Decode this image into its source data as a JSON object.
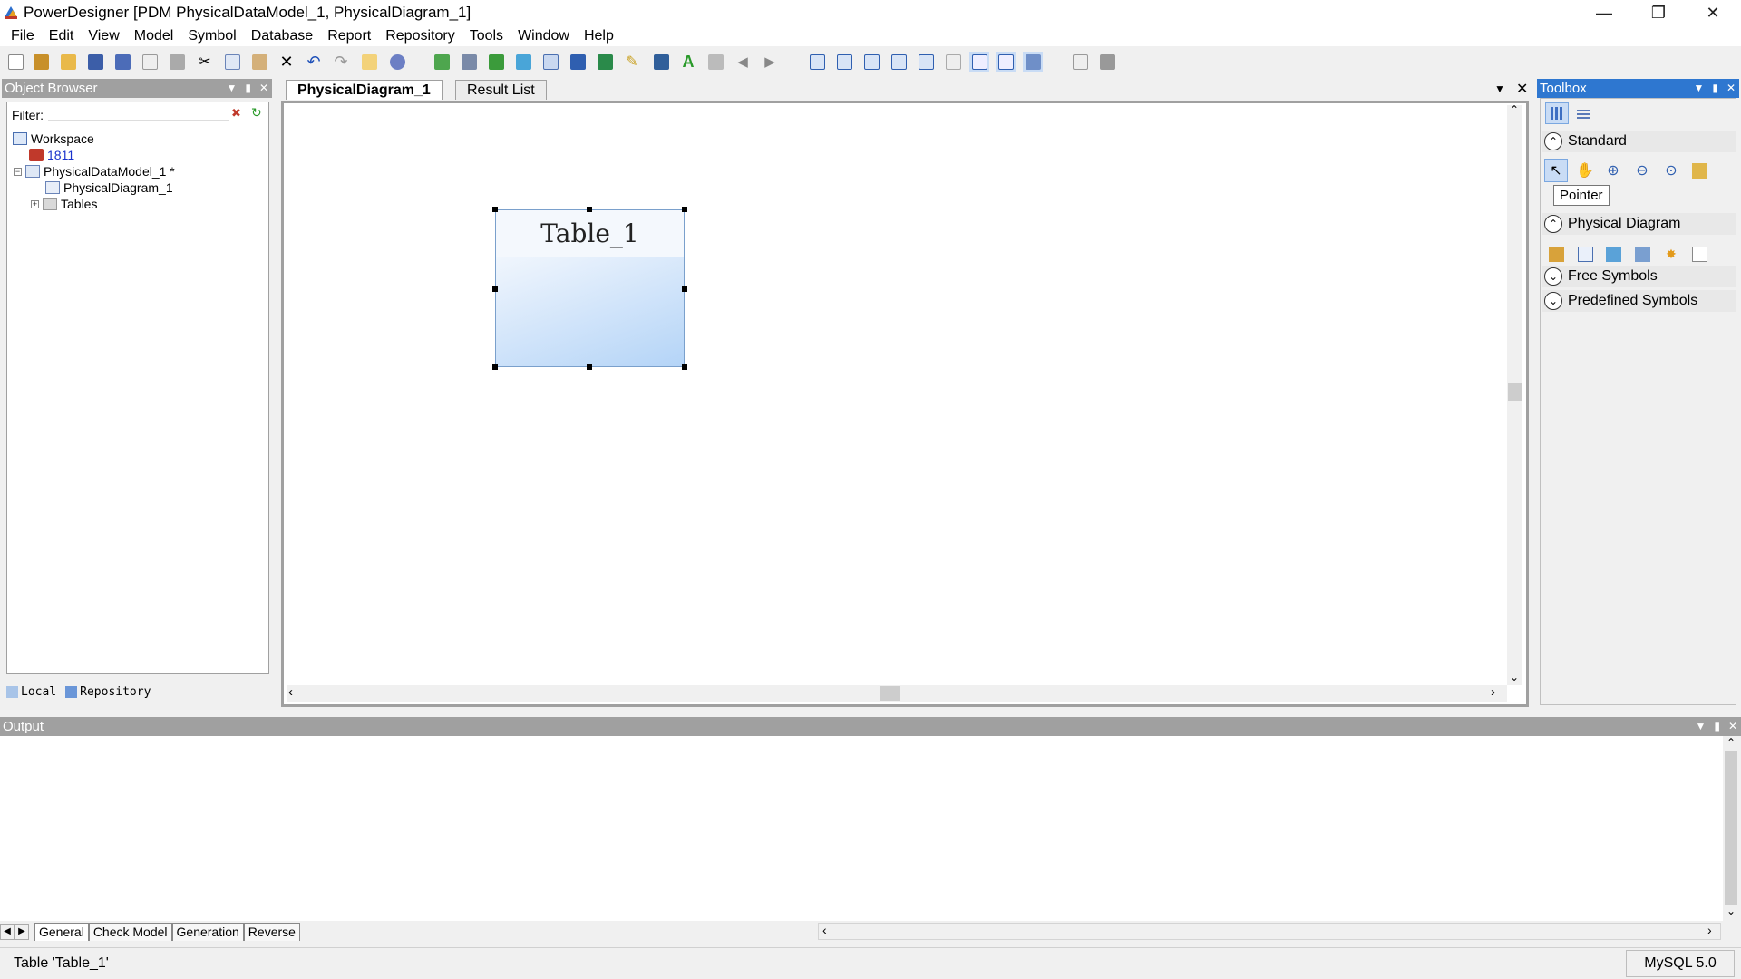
{
  "window": {
    "title": "PowerDesigner [PDM PhysicalDataModel_1, PhysicalDiagram_1]",
    "controls": [
      "minimize-icon",
      "restore-icon",
      "close-icon"
    ]
  },
  "menu": [
    "File",
    "Edit",
    "View",
    "Model",
    "Symbol",
    "Database",
    "Report",
    "Repository",
    "Tools",
    "Window",
    "Help"
  ],
  "object_browser": {
    "title": "Object Browser",
    "filter_label": "Filter:",
    "filter_value": "",
    "tree": {
      "workspace": "Workspace",
      "item_1811": "1811",
      "model": "PhysicalDataModel_1 *",
      "diagram": "PhysicalDiagram_1",
      "tables": "Tables"
    },
    "tabs": {
      "local": "Local",
      "repository": "Repository"
    }
  },
  "document": {
    "tabs": {
      "diagram": "PhysicalDiagram_1",
      "result": "Result List"
    },
    "table_symbol_name": "Table_1"
  },
  "toolbox": {
    "title": "Toolbox",
    "sections": {
      "standard": "Standard",
      "physical": "Physical Diagram",
      "free": "Free Symbols",
      "predefined": "Predefined Symbols"
    },
    "tooltip": "Pointer"
  },
  "output": {
    "title": "Output",
    "tabs": {
      "general": "General",
      "check": "Check Model",
      "generation": "Generation",
      "reverse": "Reverse"
    }
  },
  "status": {
    "text": "Table 'Table_1'",
    "dbms": "MySQL 5.0"
  },
  "colors": {
    "toolbox_header": "#2e77d0",
    "panel_header": "#a0a0a0",
    "link_blue": "#1a33cc"
  }
}
